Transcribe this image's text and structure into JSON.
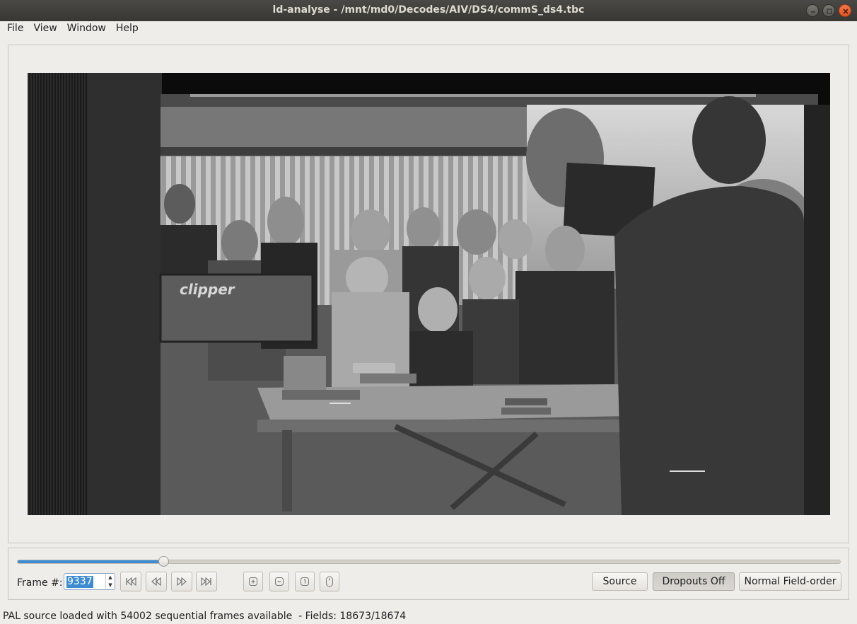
{
  "window": {
    "title": "ld-analyse - /mnt/md0/Decodes/AIV/DS4/commS_ds4.tbc"
  },
  "menu": {
    "items": [
      "File",
      "View",
      "Window",
      "Help"
    ]
  },
  "video": {
    "description_icon": "video-frame-image"
  },
  "controls": {
    "slider_position_fraction": 0.177,
    "frame_label": "Frame #:",
    "frame_value": "9337",
    "nav_buttons": [
      "first-frame-icon",
      "previous-frame-icon",
      "next-frame-icon",
      "last-frame-icon"
    ],
    "tool_buttons": [
      "zoom-in-icon",
      "zoom-out-icon",
      "zoom-original-icon",
      "mouse-icon"
    ],
    "source_label": "Source",
    "dropouts_label": "Dropouts Off",
    "field_order_label": "Normal Field-order"
  },
  "status": {
    "text": "PAL source loaded with 54002 sequential frames available  - Fields: 18673/18674"
  },
  "colors": {
    "accent": "#3d8bd0",
    "titlebar": "#3c3b37",
    "close_button": "#e95420"
  }
}
